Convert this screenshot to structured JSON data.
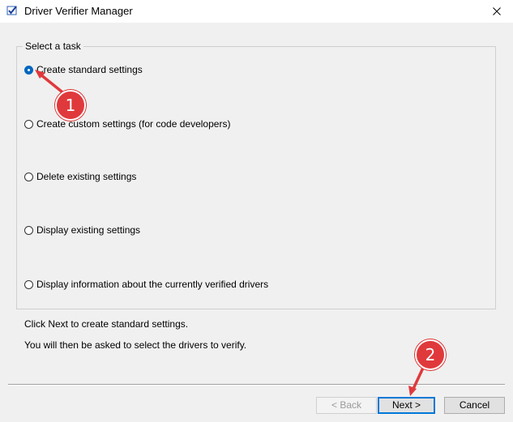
{
  "window": {
    "title": "Driver Verifier Manager",
    "close_glyph": "✕"
  },
  "task_group": {
    "legend": "Select a task",
    "options": [
      {
        "label": "Create standard settings",
        "checked": true
      },
      {
        "label": "Create custom settings (for code developers)",
        "checked": false
      },
      {
        "label": "Delete existing settings",
        "checked": false
      },
      {
        "label": "Display existing settings",
        "checked": false
      },
      {
        "label": "Display information about the currently verified drivers",
        "checked": false
      }
    ]
  },
  "info": {
    "line1": "Click Next to create standard settings.",
    "line2": "You will then be asked to select the drivers to verify."
  },
  "buttons": {
    "back": "< Back",
    "next": "Next >",
    "cancel": "Cancel"
  },
  "annotations": {
    "badge1": "1",
    "badge2": "2",
    "color": "#e0393c"
  }
}
